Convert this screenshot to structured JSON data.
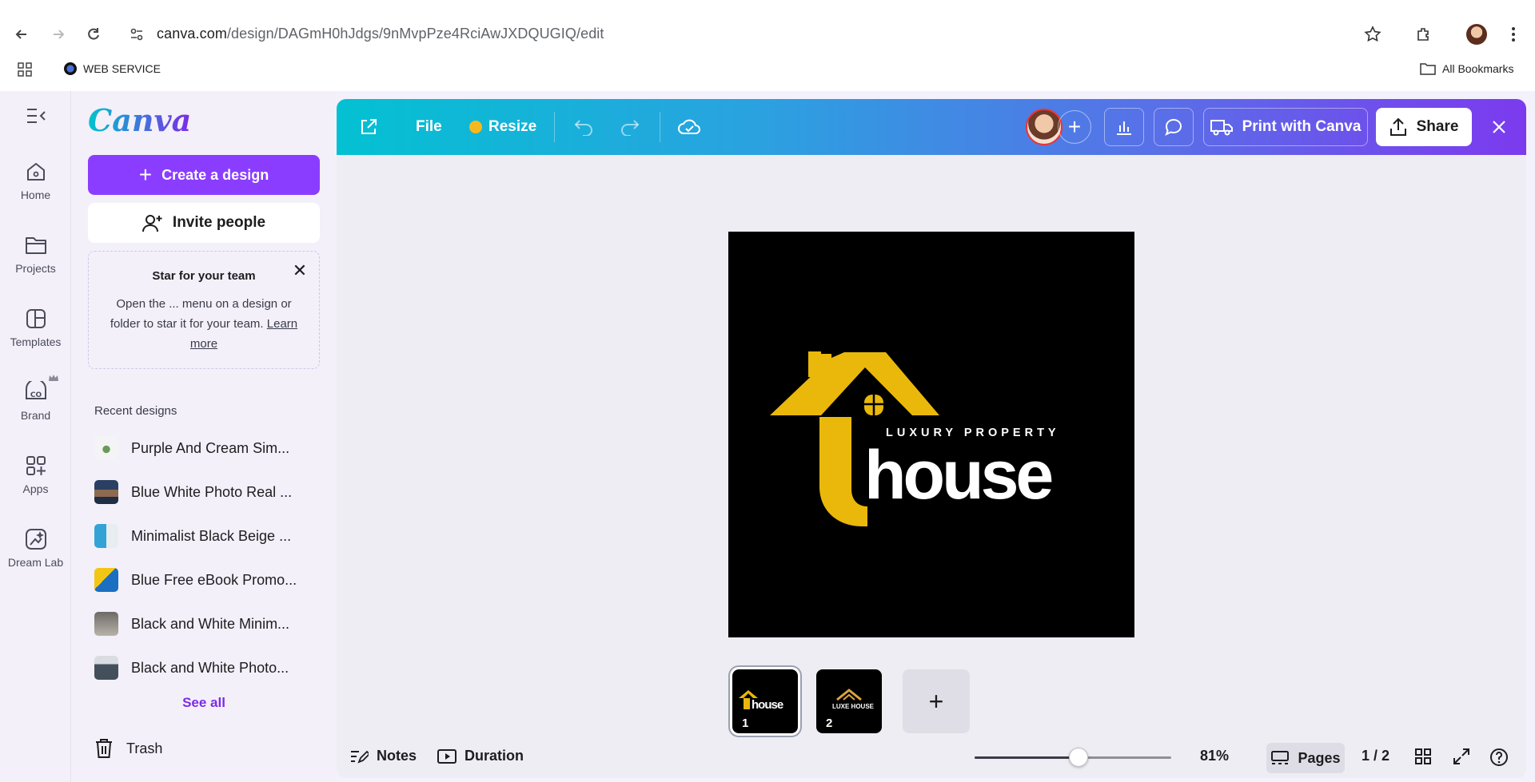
{
  "browser": {
    "url_host": "canva.com",
    "url_path": "/design/DAGmH0hJdgs/9nMvpPze4RciAwJXDQUGIQ/edit",
    "bookmark_web_service": "WEB SERVICE",
    "all_bookmarks": "All Bookmarks"
  },
  "rail": {
    "items": [
      {
        "label": "Home",
        "icon": "home-icon"
      },
      {
        "label": "Projects",
        "icon": "folder-icon"
      },
      {
        "label": "Templates",
        "icon": "templates-icon"
      },
      {
        "label": "Brand",
        "icon": "brand-icon"
      },
      {
        "label": "Apps",
        "icon": "apps-icon"
      },
      {
        "label": "Dream Lab",
        "icon": "dream-lab-icon"
      }
    ]
  },
  "panel": {
    "logo": "Canva",
    "create_label": "Create a design",
    "invite_label": "Invite people",
    "star_card": {
      "title": "Star for your team",
      "body": "Open the ... menu on a design or folder to star it for your team.",
      "link": "Learn more"
    },
    "recent_label": "Recent designs",
    "recent": [
      {
        "title": "Purple And Cream Sim..."
      },
      {
        "title": "Blue White Photo Real ..."
      },
      {
        "title": "Minimalist Black Beige ..."
      },
      {
        "title": "Blue Free eBook Promo..."
      },
      {
        "title": "Black and White Minim..."
      },
      {
        "title": "Black and White Photo..."
      }
    ],
    "see_all": "See all",
    "trash": "Trash"
  },
  "toolbar": {
    "file": "File",
    "resize": "Resize",
    "print": "Print with Canva",
    "share": "Share"
  },
  "design": {
    "tagline": "LUXURY PROPERTY",
    "word": "house",
    "thumb1_caption": "house",
    "thumb2_caption": "LUXE HOUSE"
  },
  "pages": {
    "thumbs": [
      {
        "num": "1"
      },
      {
        "num": "2"
      }
    ],
    "add_label": "+"
  },
  "bottom": {
    "notes": "Notes",
    "duration": "Duration",
    "zoom": "81%",
    "zoom_fraction": 0.53,
    "pages_label": "Pages",
    "page_counter": "1 / 2"
  },
  "colors": {
    "accent": "#8b3dff",
    "gold": "#e9b80a",
    "topbar_start": "#03c1d2",
    "topbar_end": "#7c3aee"
  }
}
